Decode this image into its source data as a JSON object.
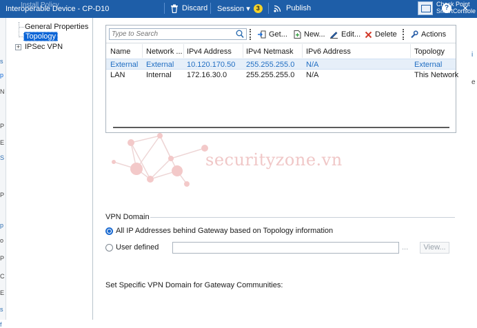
{
  "topbar": {
    "ghost_label": "Install Policy",
    "title": "Interoperable Device - CP-D10",
    "discard_label": "Discard",
    "session_label": "Session ▾",
    "session_badge": "3",
    "publish_label": "Publish",
    "brand_line1": "Check Point",
    "brand_line2": "SmartConsole"
  },
  "tree": {
    "items": [
      {
        "label": "General Properties"
      },
      {
        "label": "Topology"
      },
      {
        "label": "IPSec VPN"
      }
    ],
    "expander": "+"
  },
  "toolbar": {
    "search_placeholder": "Type to Search",
    "get_label": "Get...",
    "new_label": "New...",
    "edit_label": "Edit...",
    "delete_label": "Delete",
    "actions_label": "Actions"
  },
  "table": {
    "columns": [
      "Name",
      "Network ...",
      "IPv4 Address",
      "IPv4 Netmask",
      "IPv6 Address",
      "Topology"
    ],
    "rows": [
      [
        "External",
        "External",
        "10.120.170.50",
        "255.255.255.0",
        "N/A",
        "External"
      ],
      [
        "LAN",
        "Internal",
        "172.16.30.0",
        "255.255.255.0",
        "N/A",
        "This Network"
      ]
    ]
  },
  "watermark": {
    "text": "securityzone.vn"
  },
  "vpn_domain": {
    "title": "VPN Domain",
    "option_all": "All IP Addresses behind Gateway based on Topology information",
    "option_user": "User defined",
    "dots": "...",
    "view_label": "View...",
    "communities_label": "Set Specific VPN Domain for Gateway Communities:"
  },
  "colors": {
    "accent": "#1e5ea8",
    "selection": "#0a64d6",
    "link": "#1f6dc2"
  }
}
